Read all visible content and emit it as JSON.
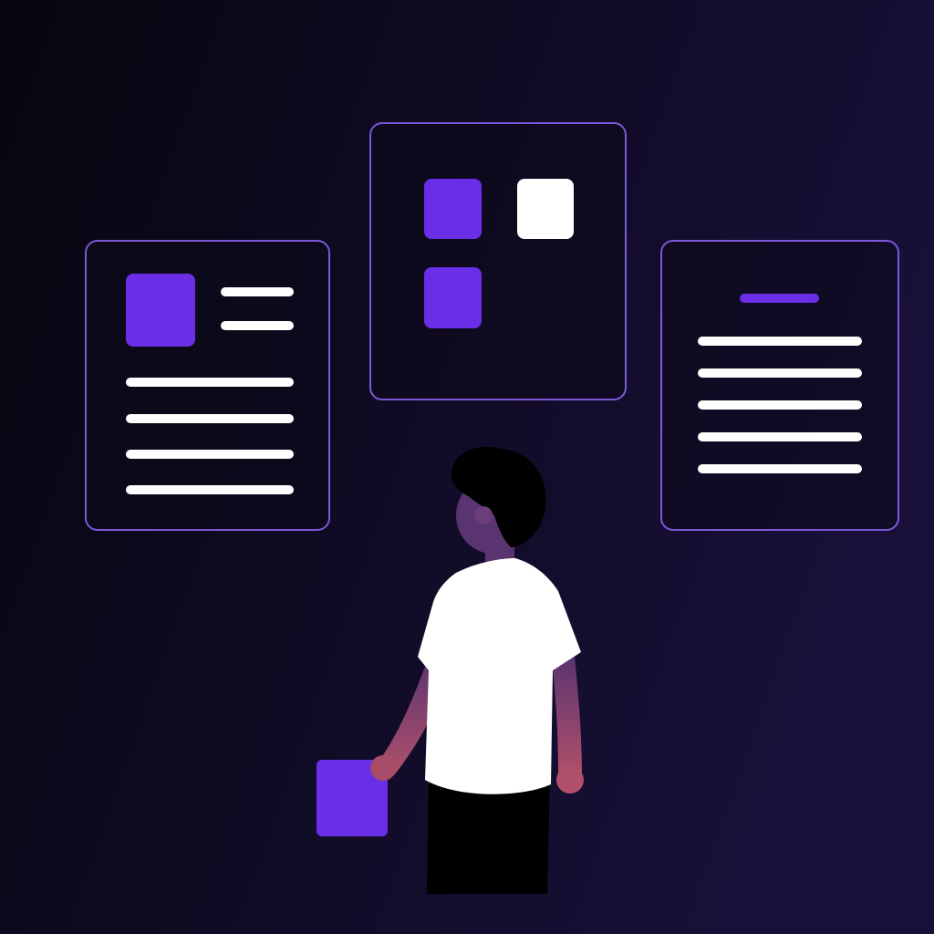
{
  "colors": {
    "background_start": "#07060f",
    "background_end": "#181038",
    "accent": "#6a2ee6",
    "card_border": "#7b58d8",
    "line": "#ffffff",
    "shirt": "#ffffff",
    "pants": "#000000",
    "hair": "#000000",
    "skin_top": "#5a3470",
    "skin_bottom": "#b0506a"
  },
  "icons": {
    "left_card": "document-with-image-icon",
    "center_card": "app-grid-icon",
    "right_card": "text-document-icon",
    "held_block": "purple-block-icon"
  }
}
